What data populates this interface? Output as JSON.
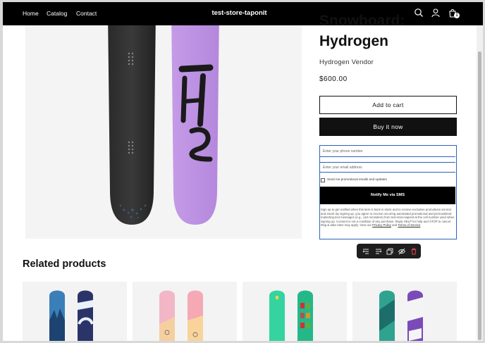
{
  "header": {
    "nav": [
      "Home",
      "Catalog",
      "Contact"
    ],
    "store_name": "test-store-taponit",
    "icons": [
      "search-icon",
      "account-icon",
      "cart-icon"
    ],
    "cart_count": "1"
  },
  "product": {
    "title_line1": "Snowboard:",
    "title_line2": "Hydrogen",
    "vendor": "Hydrogen Vendor",
    "price": "$600.00",
    "add_to_cart": "Add to cart",
    "buy_now": "Buy it now"
  },
  "sms_form": {
    "phone_placeholder": "Enter your phone number",
    "email_placeholder": "Enter your email address",
    "checkbox_label": "Send me promotional emails and updates",
    "checkbox_checked": false,
    "notify_button": "Notify Me via SMS",
    "legal_text": "Sign up to get notified when this item is back in stock and to receive exclusive promotions via text and email. By signing up, you agree to receive recurring automated promotional and personalized marketing text messages (e.g., cart reminders) from test-store-taponit at the cell number used when signing up. Consent is not a condition of any purchase. Reply HELP for help and STOP to cancel. Msg & data rates may apply. View our",
    "privacy_link": "Privacy Policy",
    "and_text": "and",
    "terms_link": "Terms of Service"
  },
  "floating_toolbar": {
    "icons": [
      "list-indent-icon",
      "list-outdent-icon",
      "duplicate-icon",
      "hide-icon",
      "delete-icon"
    ],
    "delete_color": "#e5484d"
  },
  "related": {
    "heading": "Related products"
  },
  "colors": {
    "header_bg": "#000000",
    "accent_border": "#2b63b8",
    "snowboard_purple": "#c59be8"
  }
}
